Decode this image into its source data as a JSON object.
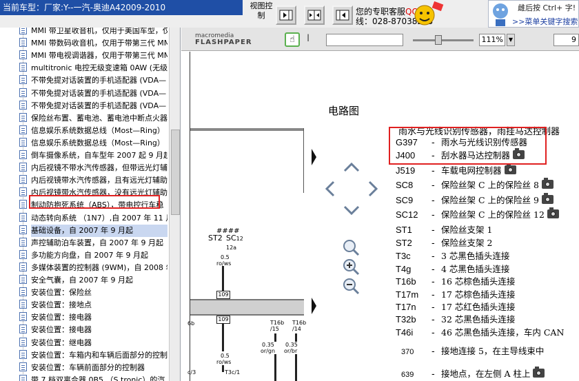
{
  "header": {
    "car_title": "当前车型：厂家:Y--一汽-奥迪A42009-2010",
    "view_label": "视图控制",
    "service_line1_prefix": "您的专职客服",
    "service_qq": "QQ:19",
    "service_line2": "线：028-87038205",
    "hint_line1": "雌后按    Ctrl+    字!",
    "hint_link": ">>菜单关键字搜索"
  },
  "tree": {
    "items": [
      {
        "label": "MMI 带卫星收音机，仅用于美国车型，仅"
      },
      {
        "label": "MMI 带数码收音机，仅用于带第三代 MMI"
      },
      {
        "label": "MMI 带电视调谐器，仅用于带第三代 MMI"
      },
      {
        "label": "multitronic 电控无级变速箱 0AW (无级"
      },
      {
        "label": "不带免提对话装置的手机适配器 (VDA—"
      },
      {
        "label": "不带免提对话装置的手机适配器 (VDA—"
      },
      {
        "label": "不带免提对话装置的手机适配器 (VDA—"
      },
      {
        "label": "保险丝布置、蓄电池、蓄电池中断点火器"
      },
      {
        "label": "信息娱乐系统数据总线（Most—Ring）"
      },
      {
        "label": "信息娱乐系统数据总线（Most—Ring）"
      },
      {
        "label": "倒车摄像系统，自车型年 2007 起 9 月起"
      },
      {
        "label": "内后视镜不带水汽传感器，但带远光灯辅助"
      },
      {
        "label": "内后视镜带水汽传感器，且有远光灯辅助"
      },
      {
        "label": "内后视镜带水汽传感器，没有远光灯辅助"
      },
      {
        "label": "制动防抱死系统（ABS），带电控行车稳"
      },
      {
        "label": "动态转向系统 （1N7）,自 2007 年 11 月"
      },
      {
        "label": "基础设备，自 2007 年 9 月起",
        "selected": true
      },
      {
        "label": "声控辅助泊车装置，自 2007 年 9 月起"
      },
      {
        "label": "多功能方向盘，自 2007 年 9 月起"
      },
      {
        "label": "多媒体装置的控制器 (9WM)，自 2008 年"
      },
      {
        "label": "安全气囊，自 2007 年 9 月起"
      },
      {
        "label": "安装位置：保险丝"
      },
      {
        "label": "安装位置：接地点"
      },
      {
        "label": "安装位置：接电器"
      },
      {
        "label": "安装位置：接电器"
      },
      {
        "label": "安装位置：继电器"
      },
      {
        "label": "安装位置：车箱内和车辆后面部分的控制"
      },
      {
        "label": "安装位置：车辆前面部分的控制器"
      },
      {
        "label": "带 7 档双离合器 0B5 （S tronic）的汽"
      }
    ]
  },
  "viewer": {
    "logo_line1": "macromedia",
    "logo_line2": "FLASHPAPER",
    "zoom": "111%",
    "page": "9"
  },
  "document": {
    "title": "电路图",
    "header_text": "雨水与光线识别传感器，雨挂马达控制器",
    "diagram_labels": {
      "hash": "####",
      "st2": "ST2",
      "sc12": "SC",
      "sc12_sub": "12",
      "a12": "12a",
      "wire1_size": "0.5",
      "wire1_color": "ro/ws",
      "fuse1": "109",
      "fuse2": "109",
      "wire2_size": "0.5",
      "wire2_color": "ro/ws",
      "t3c1": "T3c/1",
      "c3": "c/3",
      "b6": "6b",
      "t16b15": "T16b /15",
      "t16b14": "T16b /14",
      "w3_size": "0.35",
      "w3_color": "or/gn",
      "w4_size": "0.35",
      "w4_color": "or/br"
    },
    "legend": [
      {
        "code": "G397",
        "desc": "雨水与光线识别传感器",
        "camera": false
      },
      {
        "code": "J400",
        "desc": "刮水器马达控制器",
        "camera": true
      },
      {
        "code": "J519",
        "desc": "车载电网控制器",
        "camera": true
      },
      {
        "code": "SC8",
        "desc": "保险丝架 C 上的保险丝 8",
        "camera": true
      },
      {
        "code": "SC9",
        "desc": "保险丝架 C 上的保险丝 9",
        "camera": true
      },
      {
        "code": "SC12",
        "desc": "保险丝架 C 上的保险丝 12",
        "camera": true
      },
      {
        "code": "ST1",
        "desc": "保险丝支架 1",
        "camera": false
      },
      {
        "code": "ST2",
        "desc": "保险丝支架 2",
        "camera": false
      },
      {
        "code": "T3c",
        "desc": "3 芯黑色插头连接",
        "camera": false
      },
      {
        "code": "T4g",
        "desc": "4 芯黑色插头连接",
        "camera": false
      },
      {
        "code": "T16b",
        "desc": "16 芯棕色插头连接",
        "camera": false
      },
      {
        "code": "T17m",
        "desc": "17 芯棕色插头连接",
        "camera": false
      },
      {
        "code": "T17n",
        "desc": "17 芯红色插头连接",
        "camera": false
      },
      {
        "code": "T32b",
        "desc": "32 芯黑色插头连接",
        "camera": false
      },
      {
        "code": "T46i",
        "desc": "46 芯黑色插头连接，车内 CAN",
        "camera": false
      },
      {
        "code": "370",
        "desc": "接地连接 5，在主导线束中",
        "camera": false
      },
      {
        "code": "639",
        "desc": "接地点，在左侧 A 柱上",
        "camera": true
      }
    ]
  }
}
